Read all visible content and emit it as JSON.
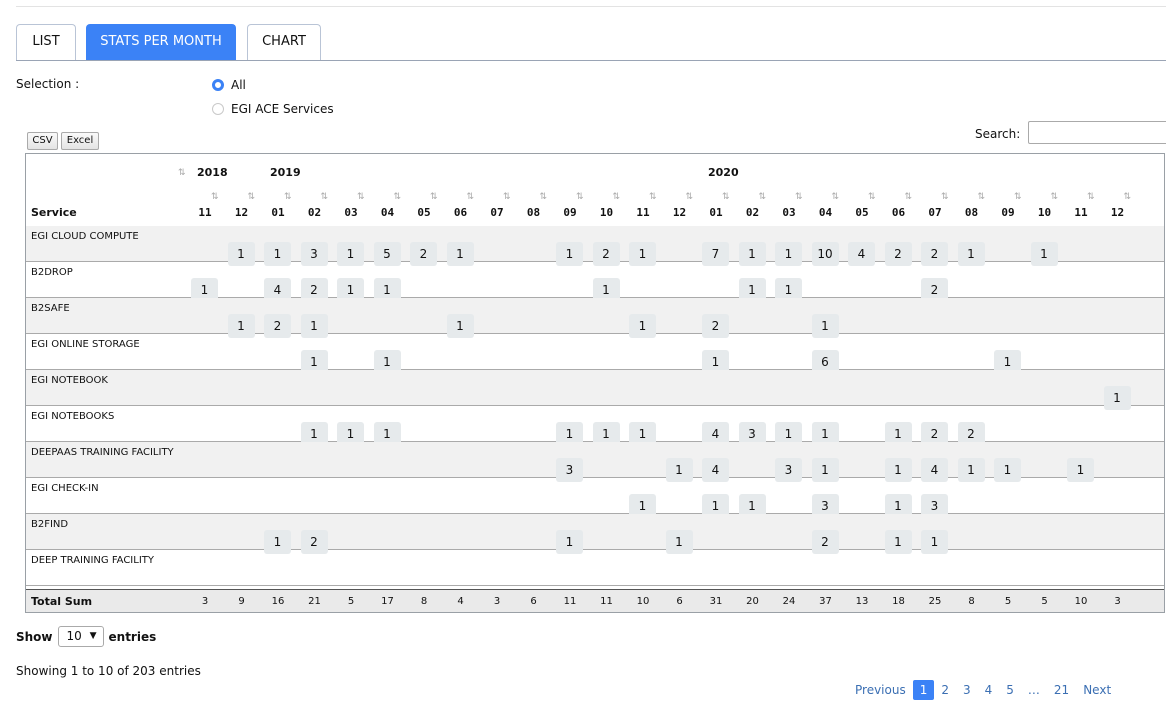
{
  "tabs": [
    {
      "label": "LIST",
      "active": false
    },
    {
      "label": "STATS PER MONTH",
      "active": true
    },
    {
      "label": "CHART",
      "active": false
    }
  ],
  "selection": {
    "label": "Selection :",
    "options": [
      {
        "label": "All",
        "selected": true
      },
      {
        "label": "EGI ACE Services",
        "selected": false
      }
    ]
  },
  "buttons": {
    "csv": "CSV",
    "excel": "Excel"
  },
  "search": {
    "label": "Search:",
    "value": ""
  },
  "table": {
    "years": [
      {
        "label": "2018",
        "col": 0
      },
      {
        "label": "2019",
        "col": 2
      },
      {
        "label": "2020",
        "col": 14
      }
    ],
    "service_header": "Service",
    "months": [
      "11",
      "12",
      "01",
      "02",
      "03",
      "04",
      "05",
      "06",
      "07",
      "08",
      "09",
      "10",
      "11",
      "12",
      "01",
      "02",
      "03",
      "04",
      "05",
      "06",
      "07",
      "08",
      "09",
      "10",
      "11",
      "12"
    ],
    "rows": [
      {
        "name": "EGI CLOUD COMPUTE",
        "values": [
          null,
          1,
          1,
          3,
          1,
          5,
          2,
          1,
          null,
          null,
          1,
          2,
          1,
          null,
          7,
          1,
          1,
          10,
          4,
          2,
          2,
          1,
          null,
          1,
          null,
          null
        ]
      },
      {
        "name": "B2DROP",
        "values": [
          1,
          null,
          4,
          2,
          1,
          1,
          null,
          null,
          null,
          null,
          null,
          1,
          null,
          null,
          null,
          1,
          1,
          null,
          null,
          null,
          2,
          null,
          null,
          null,
          null,
          null
        ]
      },
      {
        "name": "B2SAFE",
        "values": [
          null,
          1,
          2,
          1,
          null,
          null,
          null,
          1,
          null,
          null,
          null,
          null,
          1,
          null,
          2,
          null,
          null,
          1,
          null,
          null,
          null,
          null,
          null,
          null,
          null,
          null
        ]
      },
      {
        "name": "EGI ONLINE STORAGE",
        "values": [
          null,
          null,
          null,
          1,
          null,
          1,
          null,
          null,
          null,
          null,
          null,
          null,
          null,
          null,
          1,
          null,
          null,
          6,
          null,
          null,
          null,
          null,
          1,
          null,
          null,
          null
        ]
      },
      {
        "name": "EGI NOTEBOOK",
        "values": [
          null,
          null,
          null,
          null,
          null,
          null,
          null,
          null,
          null,
          null,
          null,
          null,
          null,
          null,
          null,
          null,
          null,
          null,
          null,
          null,
          null,
          null,
          null,
          null,
          null,
          1
        ]
      },
      {
        "name": "EGI NOTEBOOKS",
        "values": [
          null,
          null,
          null,
          1,
          1,
          1,
          null,
          null,
          null,
          null,
          1,
          1,
          1,
          null,
          4,
          3,
          1,
          1,
          null,
          1,
          2,
          2,
          null,
          null,
          null,
          null
        ]
      },
      {
        "name": "DEEPAAS TRAINING FACILITY",
        "values": [
          null,
          null,
          null,
          null,
          null,
          null,
          null,
          null,
          null,
          null,
          3,
          null,
          null,
          1,
          4,
          null,
          3,
          1,
          null,
          1,
          4,
          1,
          1,
          null,
          1,
          null
        ]
      },
      {
        "name": "EGI CHECK-IN",
        "values": [
          null,
          null,
          null,
          null,
          null,
          null,
          null,
          null,
          null,
          null,
          null,
          null,
          1,
          null,
          1,
          1,
          null,
          3,
          null,
          1,
          3,
          null,
          null,
          null,
          null,
          null
        ]
      },
      {
        "name": "B2FIND",
        "values": [
          null,
          null,
          1,
          2,
          null,
          null,
          null,
          null,
          null,
          null,
          1,
          null,
          null,
          1,
          null,
          null,
          null,
          2,
          null,
          1,
          1,
          null,
          null,
          null,
          null,
          null
        ]
      },
      {
        "name": "DEEP TRAINING FACILITY",
        "values": [
          null,
          null,
          null,
          null,
          null,
          null,
          null,
          null,
          null,
          null,
          null,
          null,
          null,
          null,
          null,
          null,
          null,
          null,
          null,
          null,
          null,
          null,
          null,
          null,
          null,
          null
        ]
      }
    ],
    "total_label": "Total Sum",
    "totals": [
      "3",
      "9",
      "16",
      "21",
      "5",
      "17",
      "8",
      "4",
      "3",
      "6",
      "11",
      "11",
      "10",
      "6",
      "31",
      "20",
      "24",
      "37",
      "13",
      "18",
      "25",
      "8",
      "5",
      "5",
      "10",
      "3"
    ]
  },
  "length_menu": {
    "prefix": "Show",
    "value": "10",
    "suffix": "entries"
  },
  "info": "Showing 1 to 10 of 203 entries",
  "pagination": [
    "Previous",
    "1",
    "2",
    "3",
    "4",
    "5",
    "…",
    "21",
    "Next"
  ],
  "pagination_current": "1",
  "colors": {
    "accent": "#3b82f6",
    "cell_bg": "#e6eaec",
    "row_alt": "#f1f1f1"
  }
}
